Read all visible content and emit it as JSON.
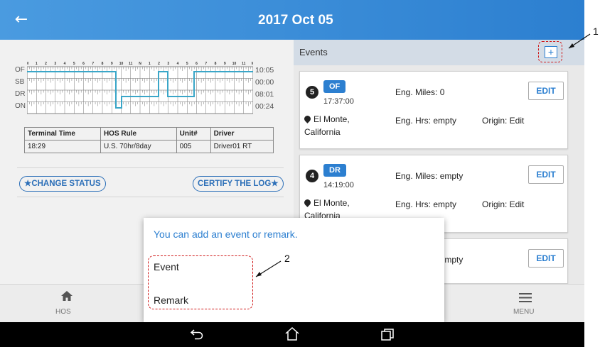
{
  "header": {
    "title": "2017 Oct 05",
    "back_icon": "arrow-left-icon"
  },
  "graph": {
    "hour_labels": [
      "M",
      "1",
      "2",
      "3",
      "4",
      "5",
      "6",
      "7",
      "8",
      "9",
      "10",
      "11",
      "N",
      "1",
      "2",
      "3",
      "4",
      "5",
      "6",
      "7",
      "8",
      "9",
      "10",
      "11",
      "M"
    ],
    "rows": [
      {
        "label": "OF",
        "total": "10:05"
      },
      {
        "label": "SB",
        "total": "00:00"
      },
      {
        "label": "DR",
        "total": "08:01"
      },
      {
        "label": "ON",
        "total": "00:24"
      }
    ]
  },
  "info_table": {
    "headers": [
      "Terminal Time",
      "HOS Rule",
      "Unit#",
      "Driver"
    ],
    "row": [
      "18:29",
      "U.S. 70hr/8day",
      "005",
      "Driver01 RT"
    ]
  },
  "actions": {
    "change_status": "CHANGE STATUS",
    "certify": "CERTIFY THE LOG"
  },
  "events": {
    "label": "Events",
    "add_label": "+",
    "cards": [
      {
        "number": "5",
        "status": "OF",
        "time": "17:37:00",
        "miles": "Eng. Miles: 0",
        "hours": "Eng. Hrs: empty",
        "origin": "Origin: Edit",
        "location": "El Monte, California",
        "edit_label": "EDIT"
      },
      {
        "number": "4",
        "status": "DR",
        "time": "14:19:00",
        "miles": "Eng. Miles: empty",
        "hours": "Eng. Hrs: empty",
        "origin": "Origin: Edit",
        "location": "El Monte, California",
        "edit_label": "EDIT"
      },
      {
        "miles": "Eng. Miles: empty",
        "edit_label": "EDIT"
      }
    ]
  },
  "dialog": {
    "message": "You can add an event or remark.",
    "options": [
      "Event",
      "Remark"
    ]
  },
  "bottom_nav": {
    "hos_label": "HOS",
    "menu_label": "MENU"
  },
  "annotations": {
    "one": "1",
    "two": "2"
  },
  "colors": {
    "accent": "#2c7fd0",
    "appbar": "#3a8fdc",
    "callout": "#d01818"
  }
}
